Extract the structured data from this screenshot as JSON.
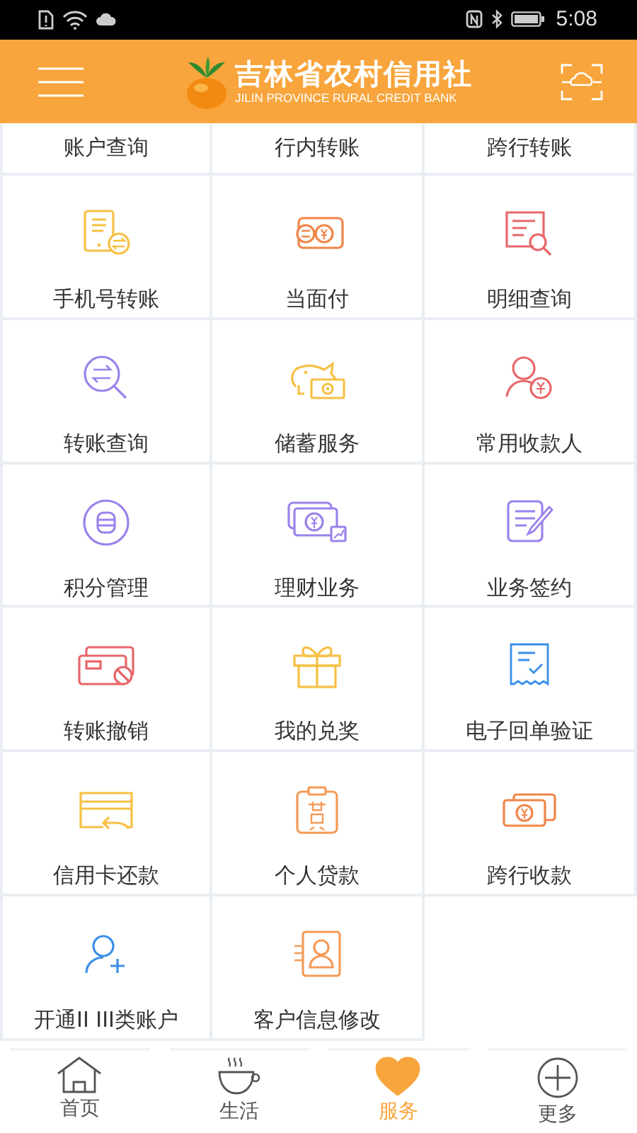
{
  "status_bar": {
    "time": "5:08"
  },
  "header": {
    "title": "吉林省农村信用社",
    "subtitle": "JILIN PROVINCE RURAL CREDIT BANK"
  },
  "partial_row": [
    {
      "label": "账户查询"
    },
    {
      "label": "行内转账"
    },
    {
      "label": "跨行转账"
    }
  ],
  "services": [
    {
      "label": "手机号转账"
    },
    {
      "label": "当面付"
    },
    {
      "label": "明细查询"
    },
    {
      "label": "转账查询"
    },
    {
      "label": "储蓄服务"
    },
    {
      "label": "常用收款人"
    },
    {
      "label": "积分管理"
    },
    {
      "label": "理财业务"
    },
    {
      "label": "业务签约"
    },
    {
      "label": "转账撤销"
    },
    {
      "label": "我的兑奖"
    },
    {
      "label": "电子回单验证"
    },
    {
      "label": "信用卡还款"
    },
    {
      "label": "个人贷款"
    },
    {
      "label": "跨行收款"
    },
    {
      "label": "开通II III类账户"
    },
    {
      "label": "客户信息修改"
    }
  ],
  "tabs": [
    {
      "label": "首页",
      "selected": false
    },
    {
      "label": "生活",
      "selected": false
    },
    {
      "label": "服务",
      "selected": true
    },
    {
      "label": "更多",
      "selected": false
    }
  ]
}
